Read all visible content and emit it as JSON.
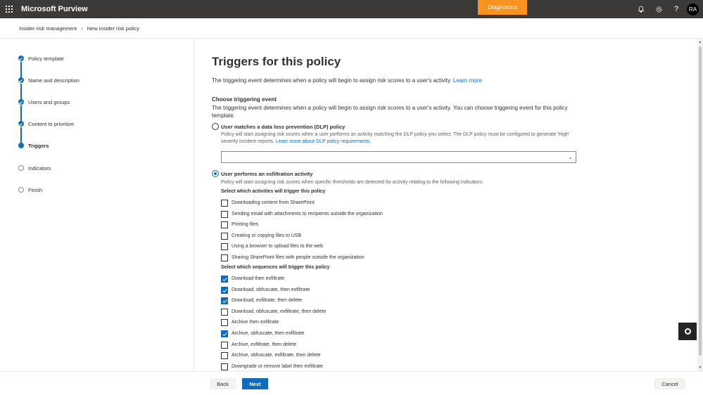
{
  "topbar": {
    "app_title": "Microsoft Purview",
    "diagnostics_label": "Diagnostics",
    "avatar_initials": "RA",
    "icons": [
      "waffle-icon",
      "bell-icon",
      "gear-icon",
      "help-icon"
    ]
  },
  "breadcrumb": {
    "items": [
      "Insider risk management",
      "New insider risk policy"
    ]
  },
  "steps": [
    {
      "label": "Policy template",
      "status": "done"
    },
    {
      "label": "Name and description",
      "status": "done"
    },
    {
      "label": "Users and groups",
      "status": "done"
    },
    {
      "label": "Content to prioritize",
      "status": "done"
    },
    {
      "label": "Triggers",
      "status": "current"
    },
    {
      "label": "Indicators",
      "status": "todo"
    },
    {
      "label": "Finish",
      "status": "todo"
    }
  ],
  "main": {
    "title": "Triggers for this policy",
    "description": "The triggering event determines when a policy will begin to assign risk scores to a user's activity.",
    "learn_more": "Learn more",
    "section_title": "Choose triggering event",
    "section_desc": "The triggering event determines when a policy will begin to assign risk scores to a user's activity. You can choose triggering event for this policy template.",
    "option_dlp": {
      "label": "User matches a data loss prevention (DLP) policy",
      "desc": "Policy will start assigning risk scores when a user performs an activity matching the DLP policy you select. The DLP policy must be configured to generate 'High' severity incident reports.",
      "link": "Learn more about DLP policy requirements.",
      "selected": false,
      "dropdown_value": ""
    },
    "option_exfil": {
      "label": "User performs an exfiltration activity",
      "desc": "Policy will start assigning risk scores when specific thresholds are detected for activity relating to the following indicators:",
      "selected": true
    },
    "activities_title": "Select which activities will trigger this policy",
    "activities": [
      {
        "label": "Downloading content from SharePoint",
        "checked": false
      },
      {
        "label": "Sending email with attachments to recipients outside the organization",
        "checked": false
      },
      {
        "label": "Printing files",
        "checked": false
      },
      {
        "label": "Creating or copying files to USB",
        "checked": false
      },
      {
        "label": "Using a browser to upload files to the web",
        "checked": false
      },
      {
        "label": "Sharing SharePoint files with people outside the organization",
        "checked": false
      }
    ],
    "sequences_title": "Select which sequences will trigger this policy",
    "sequences": [
      {
        "label": "Download then exfiltrate",
        "checked": true
      },
      {
        "label": "Download, obfuscate, then exfiltrate",
        "checked": true
      },
      {
        "label": "Download, exfiltrate, then delete",
        "checked": true
      },
      {
        "label": "Download, obfuscate, exfiltrate, then delete",
        "checked": false
      },
      {
        "label": "Archive then exfiltrate",
        "checked": false
      },
      {
        "label": "Archive, obfuscate, then exfiltrate",
        "checked": true
      },
      {
        "label": "Archive, exfiltrate, then delete",
        "checked": false
      },
      {
        "label": "Archive, obfuscate, exfiltrate, then delete",
        "checked": false
      },
      {
        "label": "Downgrade or remove label then exfiltrate",
        "checked": false
      }
    ]
  },
  "footer": {
    "back_label": "Back",
    "next_label": "Next",
    "cancel_label": "Cancel"
  },
  "colors": {
    "accent": "#0f6cbd",
    "topbar": "#3b3a39",
    "diagnostics": "#f7931e"
  }
}
